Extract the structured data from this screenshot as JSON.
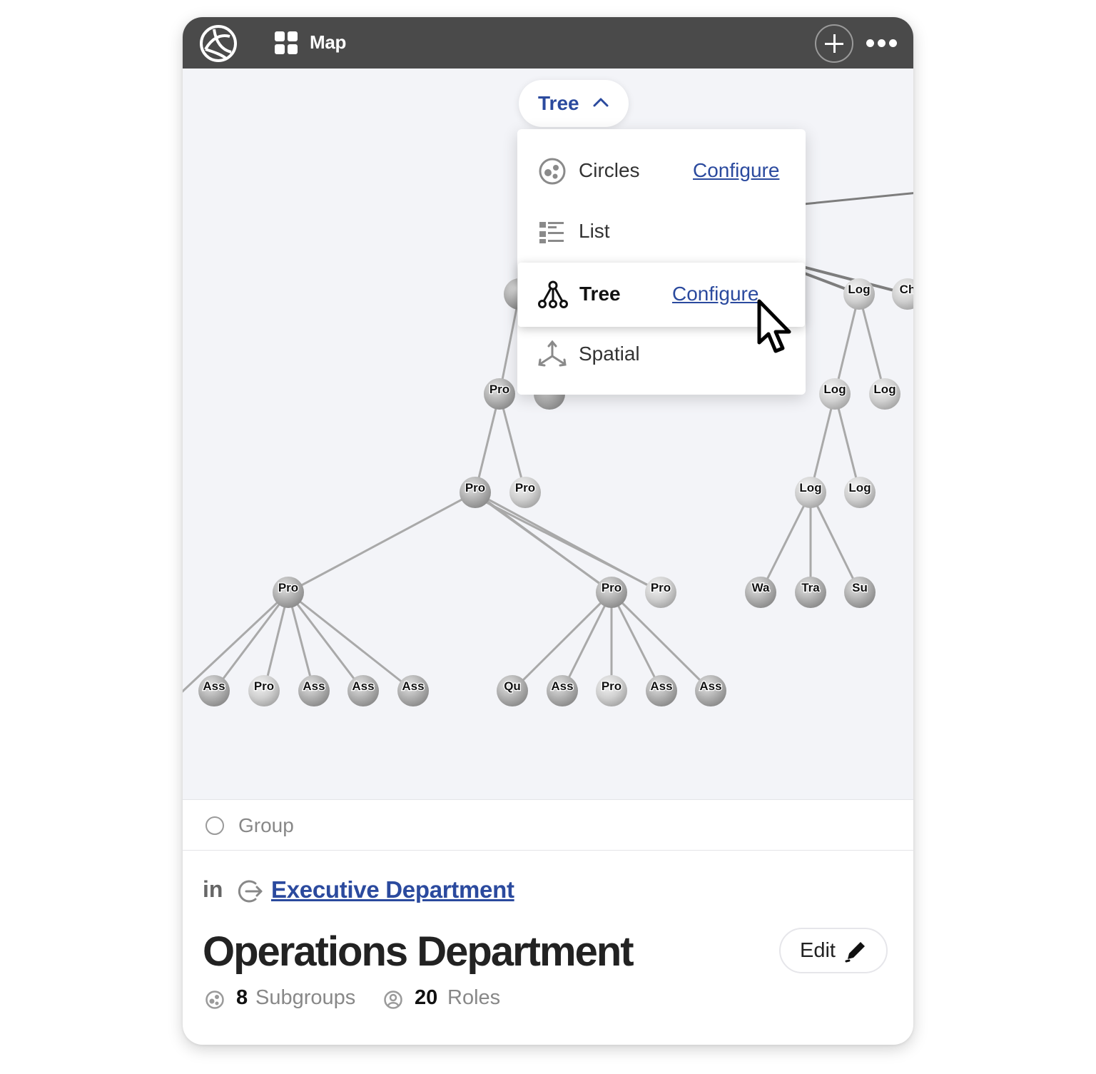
{
  "topbar": {
    "view_label": "Map",
    "icons": [
      "logo-icon",
      "grid-icon",
      "plus-icon",
      "more-icon"
    ]
  },
  "view_switcher": {
    "current": "Tree"
  },
  "view_menu": {
    "items": [
      {
        "label": "Circles",
        "icon": "circles-icon",
        "configure": "Configure"
      },
      {
        "label": "List",
        "icon": "list-icon"
      },
      {
        "label": "Tree",
        "icon": "tree-icon",
        "configure": "Configure",
        "selected": true
      },
      {
        "label": "Spatial",
        "icon": "spatial-icon"
      }
    ]
  },
  "tree": {
    "nodes": [
      {
        "id": "n0",
        "label": ""
      },
      {
        "id": "n1",
        "label": ""
      },
      {
        "id": "log1",
        "label": "Log"
      },
      {
        "id": "ch",
        "label": "Ch"
      },
      {
        "id": "pro1",
        "label": "Pro"
      },
      {
        "id": "hid",
        "label": ""
      },
      {
        "id": "log2",
        "label": "Log"
      },
      {
        "id": "log3",
        "label": "Log"
      },
      {
        "id": "pro2",
        "label": "Pro"
      },
      {
        "id": "pro3",
        "label": "Pro"
      },
      {
        "id": "log4",
        "label": "Log"
      },
      {
        "id": "log5",
        "label": "Log"
      },
      {
        "id": "pro4",
        "label": "Pro"
      },
      {
        "id": "pro5",
        "label": "Pro"
      },
      {
        "id": "pro6",
        "label": "Pro"
      },
      {
        "id": "wa",
        "label": "Wa"
      },
      {
        "id": "tra",
        "label": "Tra"
      },
      {
        "id": "su",
        "label": "Su"
      },
      {
        "id": "ass1",
        "label": "Ass"
      },
      {
        "id": "pro7",
        "label": "Pro"
      },
      {
        "id": "ass2",
        "label": "Ass"
      },
      {
        "id": "ass3",
        "label": "Ass"
      },
      {
        "id": "ass4",
        "label": "Ass"
      },
      {
        "id": "qu",
        "label": "Qu"
      },
      {
        "id": "ass5",
        "label": "Ass"
      },
      {
        "id": "pro8",
        "label": "Pro"
      },
      {
        "id": "ass6",
        "label": "Ass"
      },
      {
        "id": "ass7",
        "label": "Ass"
      }
    ],
    "edges": [
      [
        "n1",
        "log1"
      ],
      [
        "n1",
        "ch"
      ],
      [
        "log1",
        "log2"
      ],
      [
        "log1",
        "log3"
      ],
      [
        "log2",
        "log4"
      ],
      [
        "log2",
        "log5"
      ],
      [
        "log4",
        "wa"
      ],
      [
        "log4",
        "tra"
      ],
      [
        "log4",
        "su"
      ],
      [
        "n0",
        "pro1"
      ],
      [
        "pro1",
        "pro2"
      ],
      [
        "pro1",
        "pro3"
      ],
      [
        "pro2",
        "pro4"
      ],
      [
        "pro2",
        "pro5"
      ],
      [
        "pro2",
        "pro6"
      ],
      [
        "pro4",
        "offscreen"
      ],
      [
        "pro4",
        "ass1"
      ],
      [
        "pro4",
        "pro7"
      ],
      [
        "pro4",
        "ass2"
      ],
      [
        "pro4",
        "ass3"
      ],
      [
        "pro4",
        "ass4"
      ],
      [
        "pro5",
        "qu"
      ],
      [
        "pro5",
        "ass5"
      ],
      [
        "pro5",
        "pro8"
      ],
      [
        "pro5",
        "ass6"
      ],
      [
        "pro5",
        "ass7"
      ],
      [
        "topright",
        "n1b"
      ]
    ]
  },
  "group": {
    "type_label": "Group",
    "in_label": "in",
    "parent_name": "Executive Department",
    "name": "Operations Department",
    "edit_label": "Edit",
    "subgroups_count": "8",
    "subgroups_label": "Subgroups",
    "roles_count": "20",
    "roles_label": "Roles"
  },
  "colors": {
    "topbar": "#4a4a4a",
    "canvas": "#f3f4f8",
    "link": "#2b4a9e",
    "node": "#b4b4b4"
  }
}
